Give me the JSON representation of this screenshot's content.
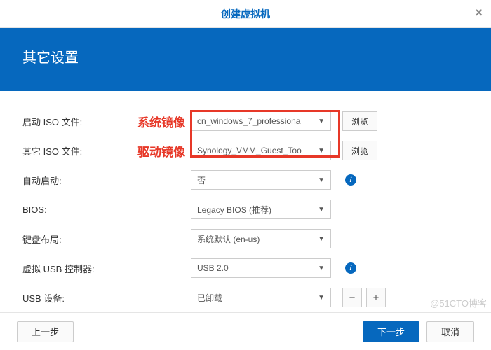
{
  "title": "创建虚拟机",
  "section_title": "其它设置",
  "annotations": {
    "iso_boot": "系统镜像",
    "iso_other": "驱动镜像"
  },
  "fields": {
    "iso_boot": {
      "label": "启动 ISO 文件:",
      "value": "cn_windows_7_professiona",
      "browse": "浏览"
    },
    "iso_other": {
      "label": "其它 ISO 文件:",
      "value": "Synology_VMM_Guest_Too",
      "browse": "浏览"
    },
    "autostart": {
      "label": "自动启动:",
      "value": "否"
    },
    "bios": {
      "label": "BIOS:",
      "value": "Legacy BIOS (推荐)"
    },
    "keyboard": {
      "label": "键盘布局:",
      "value": "系统默认 (en-us)"
    },
    "usb_ctrl": {
      "label": "虚拟 USB 控制器:",
      "value": "USB 2.0"
    },
    "usb_dev": {
      "label": "USB 设备:",
      "value": "已卸载"
    }
  },
  "buttons": {
    "prev": "上一步",
    "next": "下一步",
    "cancel": "取消"
  },
  "watermark": "@51CTO博客"
}
